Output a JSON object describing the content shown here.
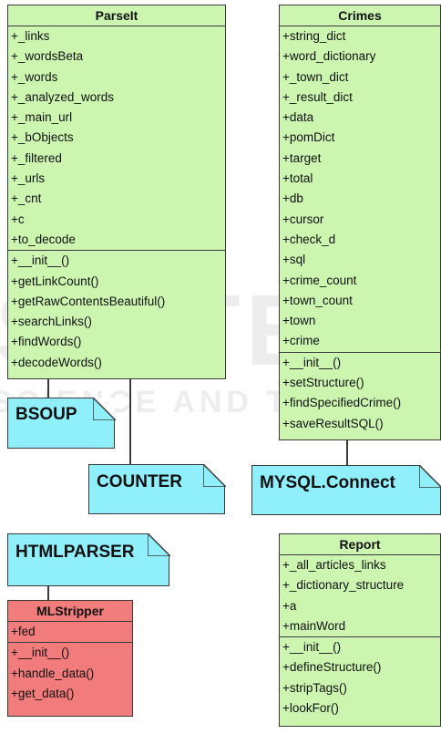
{
  "parseit": {
    "title": "ParseIt",
    "attributes": [
      "+_links",
      "+_wordsBeta",
      "+_words",
      "+_analyzed_words",
      "+_main_url",
      "+_bObjects",
      "+_filtered",
      "+_urls",
      "+_cnt",
      "+c",
      "+to_decode"
    ],
    "methods": [
      "+__init__()",
      "+getLinkCount()",
      "+getRawContentsBeautiful()",
      "+searchLinks()",
      "+findWords()",
      "+decodeWords()"
    ]
  },
  "crimes": {
    "title": "Crimes",
    "attributes": [
      "+string_dict",
      "+word_dictionary",
      "+_town_dict",
      "+_result_dict",
      "+data",
      "+pomDict",
      "+target",
      "+total",
      "+db",
      "+cursor",
      "+check_d",
      "+sql",
      "+crime_count",
      "+town_count",
      "+town",
      "+crime"
    ],
    "methods": [
      "+__init__()",
      "+setStructure()",
      "+findSpecifiedCrime()",
      "+saveResultSQL()"
    ]
  },
  "report": {
    "title": "Report",
    "attributes": [
      "+_all_articles_links",
      "+_dictionary_structure",
      "+a",
      "+mainWord"
    ],
    "methods": [
      "+__init__()",
      "+defineStructure()",
      "+stripTags()",
      "+lookFor()"
    ]
  },
  "mlstripper": {
    "title": "MLStripper",
    "attributes": [
      "+fed"
    ],
    "methods": [
      "+__init__()",
      "+handle_data()",
      "+get_data()"
    ]
  },
  "notes": {
    "bsoup": "BSOUP",
    "counter": "COUNTER",
    "mysql": "MYSQL.Connect",
    "htmlparser": "HTMLPARSER"
  },
  "colors": {
    "class_fill": "#ccf5b0",
    "red_class_fill": "#f27b7b",
    "note_fill": "#8ff0fb",
    "border": "#3a3a3a"
  }
}
